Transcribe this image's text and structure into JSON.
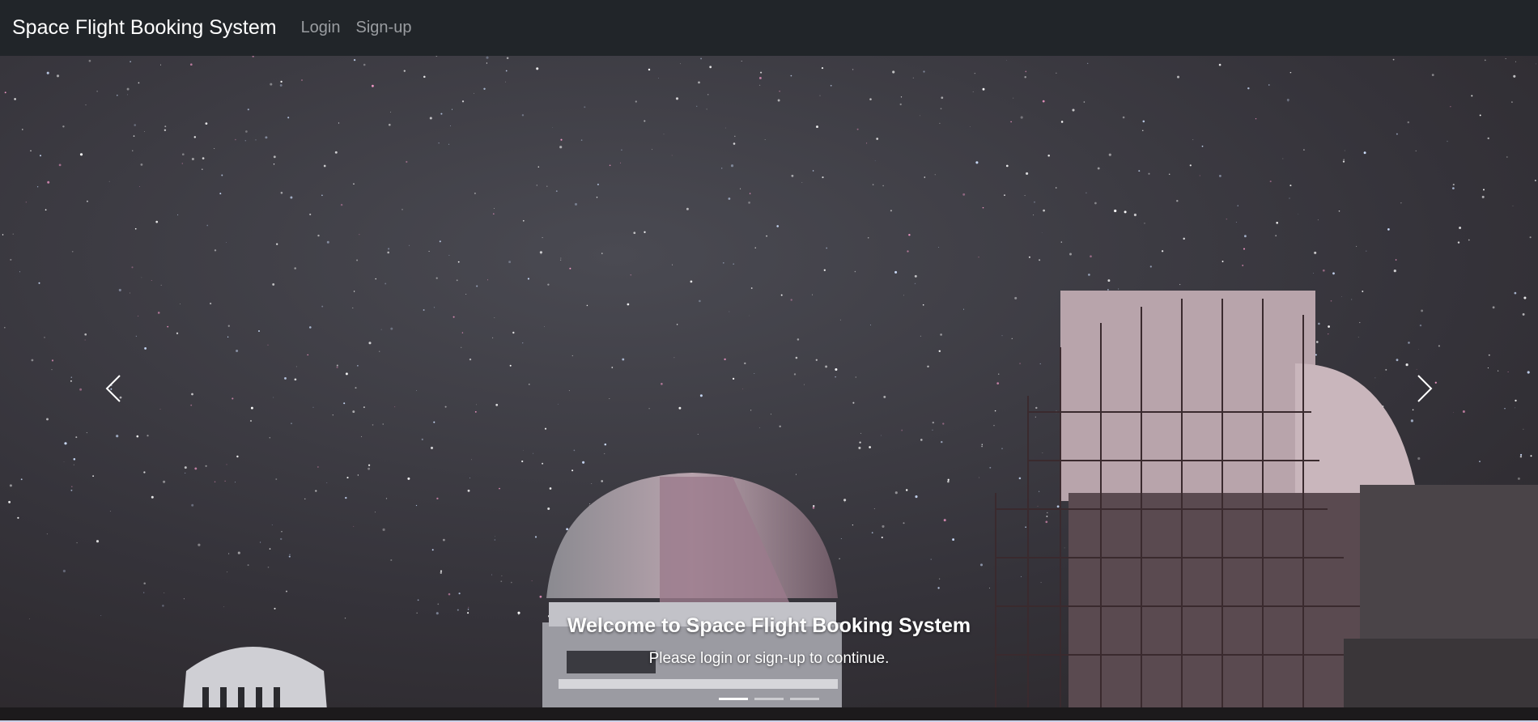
{
  "navbar": {
    "brand": "Space Flight Booking System",
    "links": [
      "Login",
      "Sign-up"
    ]
  },
  "carousel": {
    "caption_title": "Welcome to Space Flight Booking System",
    "caption_text": "Please login or sign-up to continue.",
    "active_slide": 1,
    "slide_count": 3,
    "prev_icon": "chevron-left-icon",
    "next_icon": "chevron-right-icon"
  },
  "colors": {
    "navbar_bg": "#212529",
    "brand_text": "#ffffff",
    "nav_link_text": "#9a9da1",
    "sky": "#2d2b2e"
  }
}
